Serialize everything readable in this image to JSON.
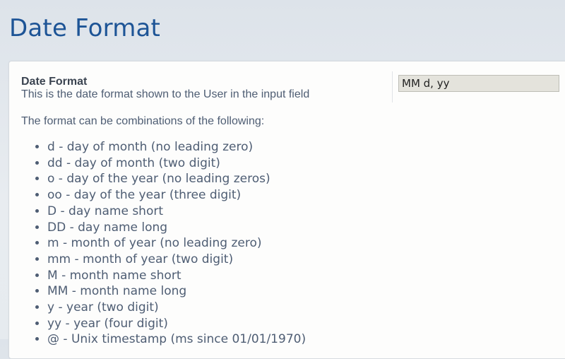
{
  "page": {
    "title": "Date Format"
  },
  "setting": {
    "label": "Date Format",
    "description": "This is the date format shown to the User in the input field",
    "input_value": "MM d, yy"
  },
  "help": {
    "intro": "The format can be combinations of the following:",
    "items": [
      "d - day of month (no leading zero)",
      "dd - day of month (two digit)",
      "o - day of the year (no leading zeros)",
      "oo - day of the year (three digit)",
      "D - day name short",
      "DD - day name long",
      "m - month of year (no leading zero)",
      "mm - month of year (two digit)",
      "M - month name short",
      "MM - month name long",
      "y - year (two digit)",
      "yy - year (four digit)",
      "@ - Unix timestamp (ms since 01/01/1970)"
    ]
  }
}
